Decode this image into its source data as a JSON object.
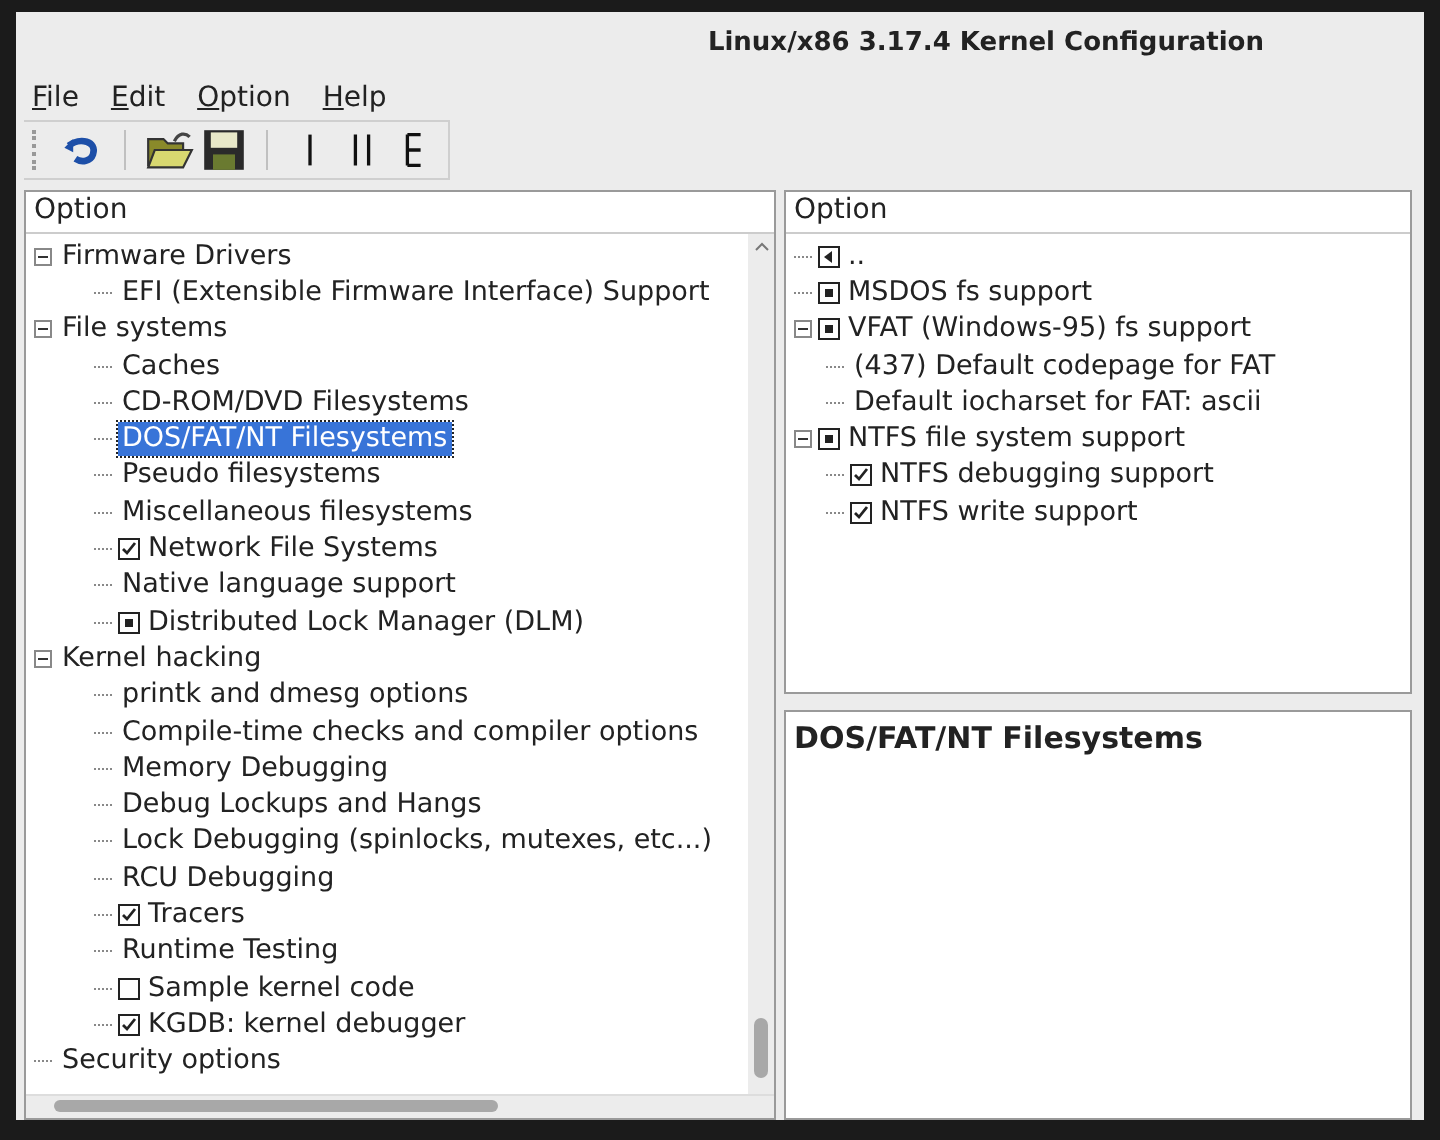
{
  "window": {
    "title": "Linux/x86 3.17.4 Kernel Configuration"
  },
  "menu": [
    "File",
    "Edit",
    "Option",
    "Help"
  ],
  "left_pane": {
    "header": "Option",
    "tree": [
      {
        "label": "Firmware Drivers",
        "kind": "plain",
        "expanded": true,
        "selected": false,
        "children": [
          {
            "label": "EFI (Extensible Firmware Interface) Support",
            "kind": "plain",
            "selected": false
          }
        ]
      },
      {
        "label": "File systems",
        "kind": "plain",
        "expanded": true,
        "selected": false,
        "children": [
          {
            "label": "Caches",
            "kind": "plain",
            "selected": false
          },
          {
            "label": "CD-ROM/DVD Filesystems",
            "kind": "plain",
            "selected": false
          },
          {
            "label": "DOS/FAT/NT Filesystems",
            "kind": "plain",
            "selected": true
          },
          {
            "label": "Pseudo filesystems",
            "kind": "plain",
            "selected": false
          },
          {
            "label": "Miscellaneous filesystems",
            "kind": "plain",
            "selected": false
          },
          {
            "label": "Network File Systems",
            "kind": "checkbox",
            "checked": true,
            "selected": false
          },
          {
            "label": "Native language support",
            "kind": "plain",
            "selected": false
          },
          {
            "label": "Distributed Lock Manager (DLM)",
            "kind": "menu",
            "selected": false
          }
        ]
      },
      {
        "label": "Kernel hacking",
        "kind": "plain",
        "expanded": true,
        "selected": false,
        "children": [
          {
            "label": "printk and dmesg options",
            "kind": "plain",
            "selected": false
          },
          {
            "label": "Compile-time checks and compiler options",
            "kind": "plain",
            "selected": false
          },
          {
            "label": "Memory Debugging",
            "kind": "plain",
            "selected": false
          },
          {
            "label": "Debug Lockups and Hangs",
            "kind": "plain",
            "selected": false
          },
          {
            "label": "Lock Debugging (spinlocks, mutexes, etc...)",
            "kind": "plain",
            "selected": false
          },
          {
            "label": "RCU Debugging",
            "kind": "plain",
            "selected": false
          },
          {
            "label": "Tracers",
            "kind": "checkbox",
            "checked": true,
            "selected": false
          },
          {
            "label": "Runtime Testing",
            "kind": "plain",
            "selected": false
          },
          {
            "label": "Sample kernel code",
            "kind": "checkbox",
            "checked": false,
            "selected": false
          },
          {
            "label": "KGDB: kernel debugger",
            "kind": "checkbox",
            "checked": true,
            "selected": false
          }
        ]
      },
      {
        "label": "Security options",
        "kind": "plain",
        "selected": false
      }
    ]
  },
  "right_pane": {
    "header": "Option",
    "tree": [
      {
        "label": "..",
        "kind": "up"
      },
      {
        "label": "MSDOS fs support",
        "kind": "menu"
      },
      {
        "label": "VFAT (Windows-95) fs support",
        "kind": "menu",
        "expanded": true,
        "children": [
          {
            "label": "(437) Default codepage for FAT",
            "kind": "plain"
          },
          {
            "label": "Default iocharset for FAT: ascii",
            "kind": "plain"
          }
        ]
      },
      {
        "label": "NTFS file system support",
        "kind": "menu",
        "expanded": true,
        "children": [
          {
            "label": "NTFS debugging support",
            "kind": "checkbox",
            "checked": true
          },
          {
            "label": "NTFS write support",
            "kind": "checkbox",
            "checked": true
          }
        ]
      }
    ]
  },
  "help_pane": {
    "title": "DOS/FAT/NT Filesystems"
  }
}
